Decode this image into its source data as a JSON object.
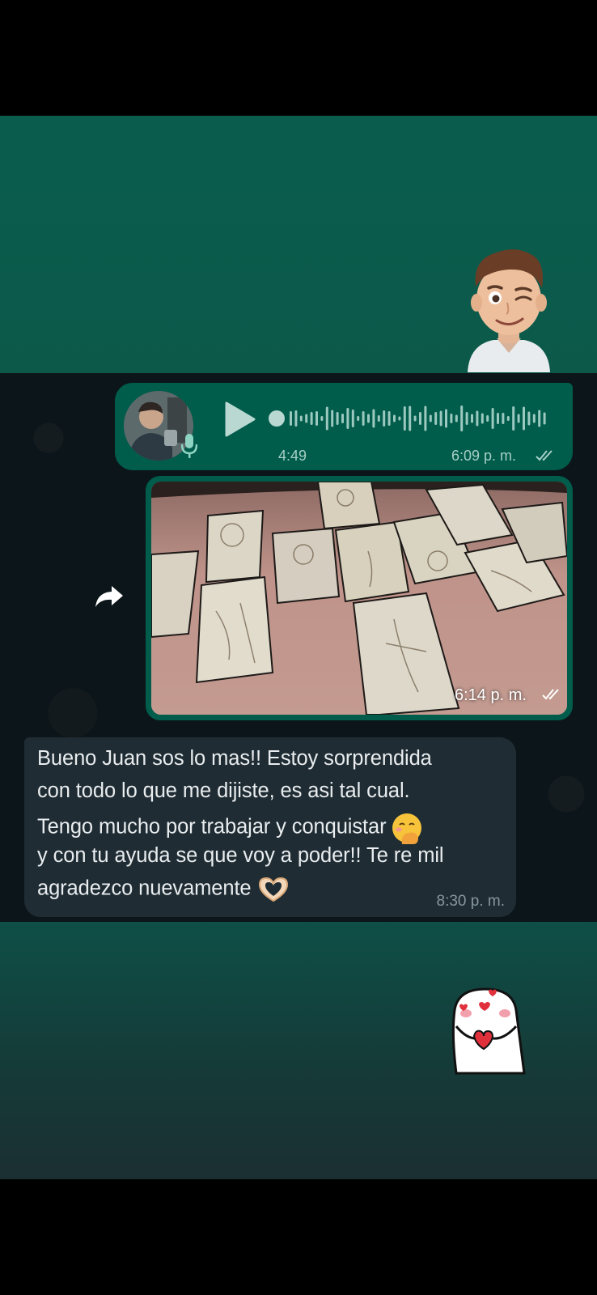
{
  "voice_message": {
    "duration": "4:49",
    "time": "6:09 p. m."
  },
  "image_message": {
    "time": "6:14 p. m."
  },
  "text_message": {
    "lines": [
      "Bueno Juan sos lo mas!! Estoy sorprendida",
      "con todo lo que me dijiste, es asi tal cual.",
      "Tengo mucho por trabajar y conquistar",
      "y con tu ayuda se que voy a poder!! Te re mil",
      "agradezco nuevamente"
    ],
    "time": "8:30 p. m."
  },
  "colors": {
    "outgoing_bubble": "#005c4b",
    "incoming_bubble": "#1f2c33",
    "chat_background": "#0c1519",
    "banner_green": "#0a5d4d"
  }
}
